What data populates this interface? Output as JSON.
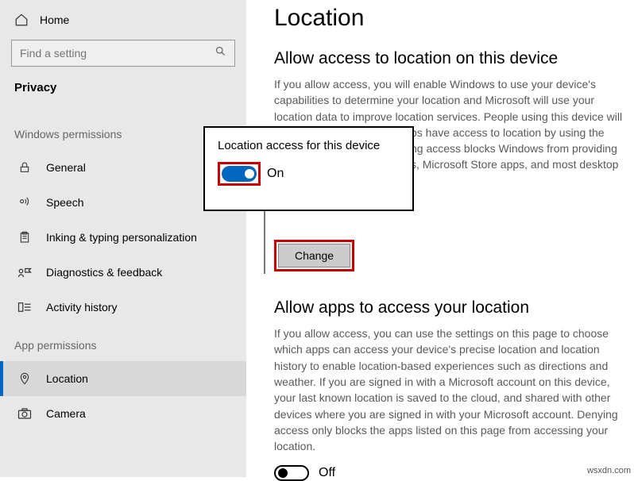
{
  "sidebar": {
    "home": "Home",
    "search_placeholder": "Find a setting",
    "category": "Privacy",
    "groups": {
      "windows": {
        "label": "Windows permissions"
      },
      "app": {
        "label": "App permissions"
      }
    },
    "items": [
      {
        "label": "General"
      },
      {
        "label": "Speech"
      },
      {
        "label": "Inking & typing personalization"
      },
      {
        "label": "Diagnostics & feedback"
      },
      {
        "label": "Activity history"
      },
      {
        "label": "Location"
      },
      {
        "label": "Camera"
      }
    ]
  },
  "main": {
    "title": "Location",
    "section1": {
      "heading": "Allow access to location on this device",
      "body": "If you allow access, you will enable Windows to use your device's capabilities to determine your location and Microsoft will use your location data to improve location services. People using this device will be able to choose if their apps have access to location by using the settings on this page. Denying access blocks Windows from providing location to Windows features, Microsoft Store apps, and most desktop apps.",
      "change_btn": "Change"
    },
    "section2": {
      "heading": "Allow apps to access your location",
      "body": "If you allow access, you can use the settings on this page to choose which apps can access your device's precise location and location history to enable location-based experiences such as directions and weather. If you are signed in with a Microsoft account on this device, your last known location is saved to the cloud, and shared with other devices where you are signed in with your Microsoft account. Denying access only blocks the apps listed on this page from accessing your location.",
      "toggle_label": "Off"
    }
  },
  "popup": {
    "title": "Location access for this device",
    "toggle_label": "On"
  },
  "watermark": "wsxdn.com"
}
